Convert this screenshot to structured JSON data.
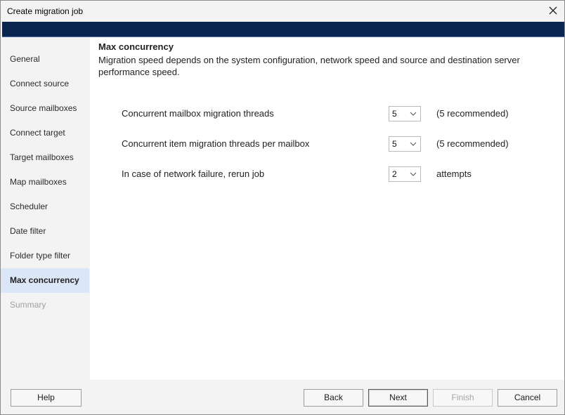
{
  "window": {
    "title": "Create migration job"
  },
  "sidebar": {
    "items": [
      {
        "label": "General",
        "state": "normal"
      },
      {
        "label": "Connect source",
        "state": "normal"
      },
      {
        "label": "Source mailboxes",
        "state": "normal"
      },
      {
        "label": "Connect target",
        "state": "normal"
      },
      {
        "label": "Target mailboxes",
        "state": "normal"
      },
      {
        "label": "Map mailboxes",
        "state": "normal"
      },
      {
        "label": "Scheduler",
        "state": "normal"
      },
      {
        "label": "Date filter",
        "state": "normal"
      },
      {
        "label": "Folder type filter",
        "state": "normal"
      },
      {
        "label": "Max concurrency",
        "state": "active"
      },
      {
        "label": "Summary",
        "state": "disabled"
      }
    ]
  },
  "main": {
    "title": "Max concurrency",
    "description": "Migration speed depends on the system configuration, network speed and source and destination server performance speed.",
    "rows": [
      {
        "label": "Concurrent mailbox migration threads",
        "value": "5",
        "note": "(5 recommended)"
      },
      {
        "label": "Concurrent item migration threads per mailbox",
        "value": "5",
        "note": "(5 recommended)"
      },
      {
        "label": "In case of network failure, rerun job",
        "value": "2",
        "note": "attempts"
      }
    ]
  },
  "footer": {
    "help": "Help",
    "back": "Back",
    "next": "Next",
    "finish": "Finish",
    "cancel": "Cancel"
  },
  "colors": {
    "banner": "#0a2550",
    "active_item_bg": "#dbe6f6"
  },
  "icons": {
    "close": "close-icon",
    "dropdown": "chevron-down-icon"
  }
}
